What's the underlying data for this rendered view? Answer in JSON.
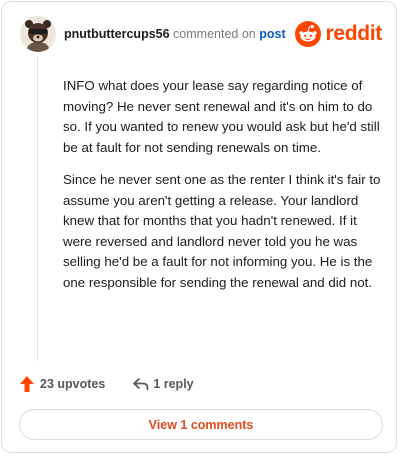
{
  "header": {
    "username": "pnutbuttercups56",
    "action_text": "commented on",
    "post_link": "post",
    "brand_name": "reddit",
    "brand_color": "#ff4500",
    "avatar_icon": "avatar-icon",
    "brand_icon": "reddit-logo-icon"
  },
  "comment": {
    "paragraphs": [
      "INFO what does your lease say regarding notice of moving? He never sent renewal and it's on him to do so. If you wanted to renew you would ask but he'd still be at fault for not sending renewals on time.",
      "Since he never sent one as the renter I think it's fair to assume you aren't getting a release. Your landlord knew that for months that you hadn't renewed. If it were reversed and landlord never told you he was selling he'd be a fault for not informing you. He is the one responsible for sending the renewal and did not."
    ]
  },
  "actions": {
    "upvotes": "23 upvotes",
    "replies": "1 reply",
    "upvote_icon": "upvote-arrow-icon",
    "reply_icon": "reply-arrow-icon",
    "upvote_color": "#ff4500"
  },
  "footer": {
    "view_comments": "View 1 comments",
    "accent_color": "#e44a1f"
  }
}
